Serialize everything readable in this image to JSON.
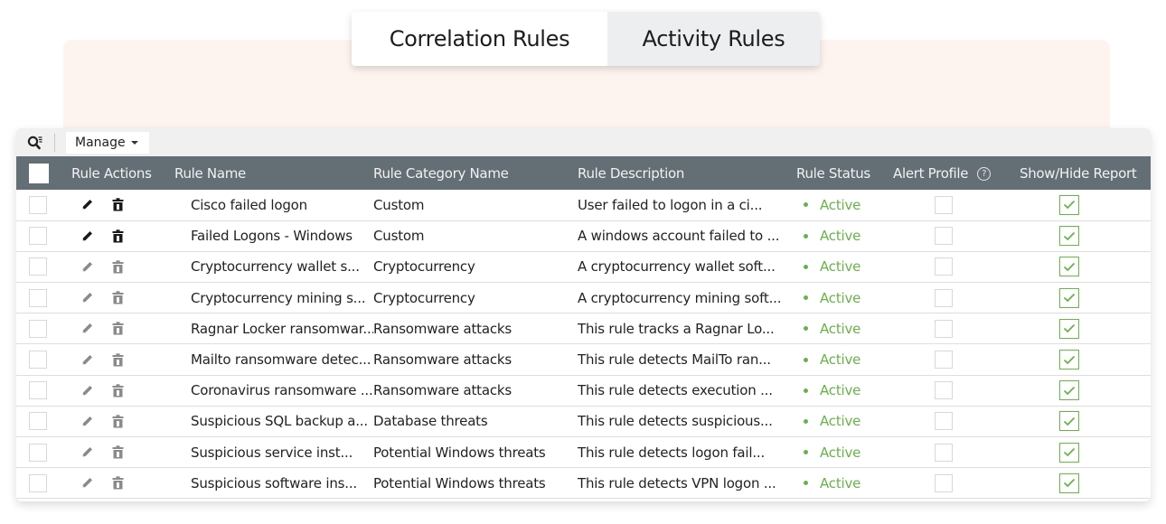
{
  "tabs": [
    {
      "label": "Correlation Rules",
      "active": true
    },
    {
      "label": "Activity Rules",
      "active": false
    }
  ],
  "toolbar": {
    "search_icon": "search-filter-icon",
    "manage_label": "Manage"
  },
  "table": {
    "columns": [
      "Rule Actions",
      "Rule Name",
      "Rule Category Name",
      "Rule Description",
      "Rule Status",
      "Alert Profile",
      "Show/Hide Report"
    ],
    "alert_profile_help": "?",
    "rows": [
      {
        "name": "Cisco failed logon",
        "category": "Custom",
        "description": "User failed to logon in a ci...",
        "status": "Active",
        "actions_enabled": true,
        "alert_profile": false,
        "show_report": true
      },
      {
        "name": "Failed Logons - Windows",
        "category": "Custom",
        "description": "A windows account failed to ...",
        "status": "Active",
        "actions_enabled": true,
        "alert_profile": false,
        "show_report": true
      },
      {
        "name": "Cryptocurrency wallet s...",
        "category": "Cryptocurrency",
        "description": "A cryptocurrency wallet soft...",
        "status": "Active",
        "actions_enabled": false,
        "alert_profile": false,
        "show_report": true
      },
      {
        "name": "Cryptocurrency mining s...",
        "category": "Cryptocurrency",
        "description": "A cryptocurrency mining soft...",
        "status": "Active",
        "actions_enabled": false,
        "alert_profile": false,
        "show_report": true
      },
      {
        "name": "Ragnar Locker ransomwar...",
        "category": "Ransomware attacks",
        "description": "This rule tracks a Ragnar Lo...",
        "status": "Active",
        "actions_enabled": false,
        "alert_profile": false,
        "show_report": true
      },
      {
        "name": "Mailto ransomware detec...",
        "category": "Ransomware attacks",
        "description": "This rule detects MailTo ran...",
        "status": "Active",
        "actions_enabled": false,
        "alert_profile": false,
        "show_report": true
      },
      {
        "name": "Coronavirus ransomware ...",
        "category": "Ransomware attacks",
        "description": "This rule detects execution ...",
        "status": "Active",
        "actions_enabled": false,
        "alert_profile": false,
        "show_report": true
      },
      {
        "name": "Suspicious SQL backup a...",
        "category": "Database threats",
        "description": "This rule detects suspicious...",
        "status": "Active",
        "actions_enabled": false,
        "alert_profile": false,
        "show_report": true
      },
      {
        "name": "Suspicious service inst...",
        "category": "Potential Windows threats",
        "description": "This rule detects logon fail...",
        "status": "Active",
        "actions_enabled": false,
        "alert_profile": false,
        "show_report": true
      },
      {
        "name": "Suspicious software ins...",
        "category": "Potential Windows threats",
        "description": "This rule detects VPN logon ...",
        "status": "Active",
        "actions_enabled": false,
        "alert_profile": false,
        "show_report": true
      }
    ]
  },
  "colors": {
    "header_bg": "#646e75",
    "status_active": "#6ab04c",
    "icon_enabled": "#1a1a1a",
    "icon_disabled": "#8a8a8a",
    "accent_bg": "#fdf3ef"
  }
}
